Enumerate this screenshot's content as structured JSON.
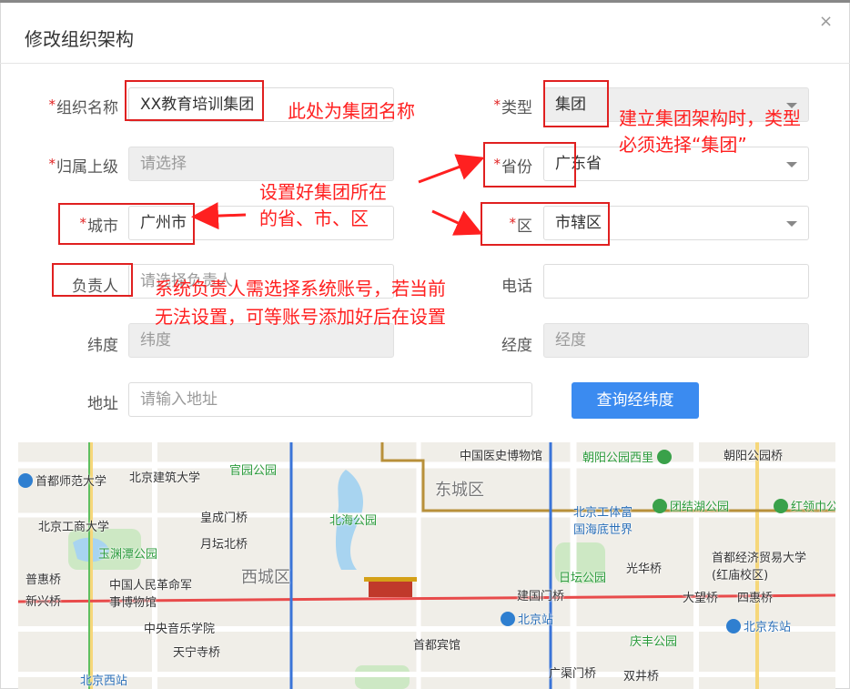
{
  "dialog": {
    "title": "修改组织架构",
    "close_glyph": "×"
  },
  "form": {
    "required_mark": "*",
    "org_name": {
      "label": "组织名称",
      "value": "XX教育培训集团"
    },
    "type": {
      "label": "类型",
      "value": "集团"
    },
    "parent": {
      "label": "归属上级",
      "placeholder": "请选择"
    },
    "province": {
      "label": "省份",
      "value": "广东省"
    },
    "city": {
      "label": "城市",
      "value": "广州市"
    },
    "district": {
      "label": "区",
      "value": "市辖区"
    },
    "manager": {
      "label": "负责人",
      "value_visible": "请选择负责人"
    },
    "phone": {
      "label": "电话",
      "value": ""
    },
    "latitude": {
      "label": "纬度",
      "placeholder": "纬度"
    },
    "longitude": {
      "label": "经度",
      "placeholder": "经度"
    },
    "address": {
      "label": "地址",
      "placeholder": "请输入地址"
    },
    "query_button": "查询经纬度"
  },
  "annotations": {
    "org_name_note": "此处为集团名称",
    "type_note_1": "建立集团架构时，类型",
    "type_note_2": "必须选择“集团”",
    "region_note_1": "设置好集团所在",
    "region_note_2": "的省、市、区",
    "manager_note_1": "系统负责人需选择系统账号，若当前",
    "manager_note_2": "无法设置，可等账号添加好后在设置"
  },
  "map": {
    "districts": [
      "东城区",
      "西城区"
    ],
    "pois": [
      "中国医史博物馆",
      "朝阳公园西里",
      "朝阳公园桥",
      "首都师范大学",
      "北京建筑大学",
      "官园公园",
      "北京工体富国海底世界",
      "团结湖公园",
      "红领巾公园",
      "北京工商大学",
      "皇成门桥",
      "北海公园",
      "玉渊潭公园",
      "月坛北桥",
      "首都经济贸易大学(红庙校区)",
      "日坛公园",
      "光华桥",
      "普惠桥",
      "中国人民革命军事博物馆",
      "新兴桥",
      "建国门桥",
      "大望桥",
      "四惠桥",
      "中央音乐学院",
      "北京站",
      "北京东站",
      "天宁寺桥",
      "首都宾馆",
      "庆丰公园",
      "北京西站",
      "广渠门桥",
      "双井桥"
    ],
    "colors": {
      "water": "#a8d4f0",
      "park": "#cde8c4",
      "road": "#ffffff",
      "metro_red": "#e84b4b",
      "metro_blue": "#3a74d8"
    }
  }
}
